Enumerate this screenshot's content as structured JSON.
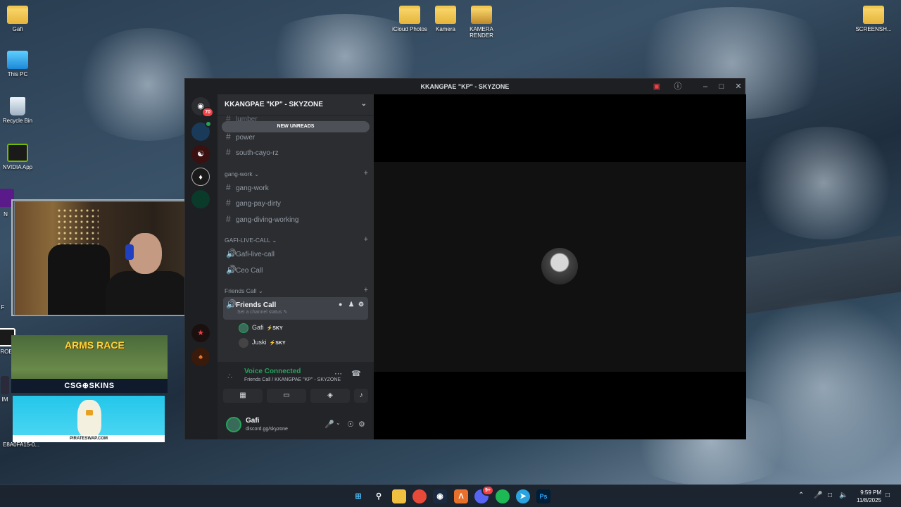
{
  "desktop": {
    "icons": [
      {
        "label": "Gafi"
      },
      {
        "label": "This PC"
      },
      {
        "label": "Recycle Bin"
      },
      {
        "label": "NVIDIA App"
      },
      {
        "label": "iCloud Photos"
      },
      {
        "label": "Kamera"
      },
      {
        "label": "KAMERA RENDER"
      },
      {
        "label": "SCREENSH..."
      },
      {
        "label": "N"
      },
      {
        "label": "F"
      },
      {
        "label": "ROE"
      },
      {
        "label": "IM"
      },
      {
        "label": "E8A0FA15-0..."
      }
    ]
  },
  "ads": {
    "arms_race": "ARMS RACE",
    "csg_skins": "CSG⊕SKINS",
    "pirateswap": "PIRATESWAP.COM"
  },
  "window": {
    "title": "KKANGPAE \"KP\" - SKYZONE",
    "servers_badge": "70"
  },
  "guild": {
    "name": "KKANGPAE \"KP\" - SKYZONE",
    "new_unreads": "NEW UNREADS",
    "channels_top": [
      "lumber",
      "power",
      "south-cayo-rz"
    ],
    "categories": {
      "gang_work": "gang-work",
      "gafi_live": "GAFI-LIVE-CALL",
      "friends_call": "Friends Call"
    },
    "gang_work_channels": [
      "gang-work",
      "gang-pay-dirty",
      "gang-diving-working"
    ],
    "gafi_live_channels": [
      "Gafi-live-call",
      "Ceo Call"
    ],
    "active_voice": {
      "name": "Friends Call",
      "status": "Set a channel status ✎"
    },
    "voice_users": [
      {
        "name": "Gafi",
        "tag": "SKY"
      },
      {
        "name": "Juski",
        "tag": "SKY"
      }
    ]
  },
  "voice_panel": {
    "title": "Voice Connected",
    "subtitle": "Friends Call / KKANGPAE \"KP\" - SKYZONE"
  },
  "user": {
    "name": "Gafi",
    "status": "discord.gg/skyzone"
  },
  "clock": {
    "time": "9:59 PM",
    "date": "11/8/2025"
  },
  "taskbar": {
    "discord_badge": "9+"
  }
}
